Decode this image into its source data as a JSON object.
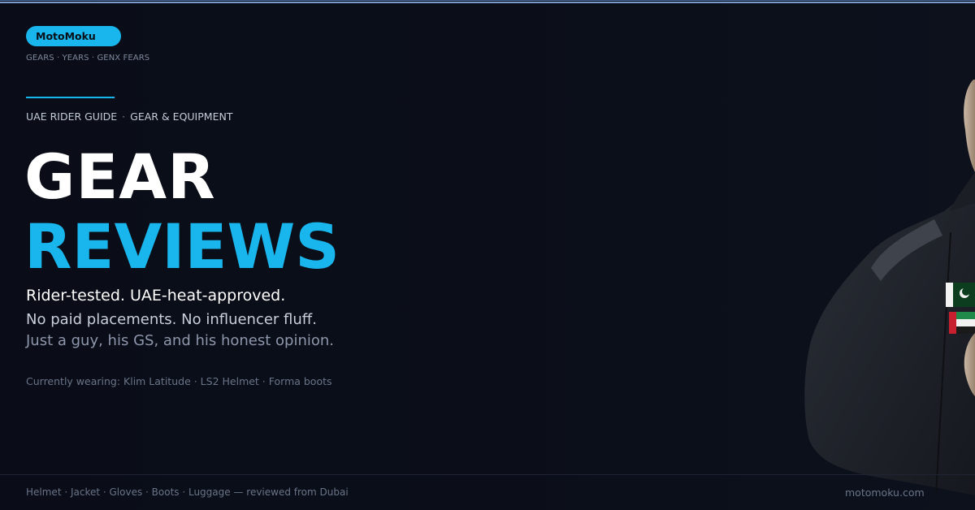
{
  "brand": {
    "name": "MotoMoku",
    "tagline": "GEARS · YEARS · GENX FEARS",
    "accent_color": "#19b6ee"
  },
  "category": {
    "primary": "UAE RIDER GUIDE",
    "separator": "·",
    "secondary": "GEAR & EQUIPMENT"
  },
  "headline": {
    "line1": "GEAR",
    "line2": "REVIEWS"
  },
  "subheadline": {
    "line1": "Rider-tested. UAE-heat-approved.",
    "line2": "No paid placements. No influencer fluff.",
    "line3": "Just a guy, his GS, and his honest opinion."
  },
  "currently_wearing": "Currently wearing: Klim Latitude · LS2 Helmet · Forma boots",
  "footer": {
    "categories": "Helmet · Jacket · Gloves · Boots · Luggage — reviewed from Dubai",
    "site": "motomoku.com"
  },
  "image": {
    "subject": "rider-photo",
    "icons": [
      "flag-pakistan-icon",
      "flag-uae-icon"
    ]
  }
}
